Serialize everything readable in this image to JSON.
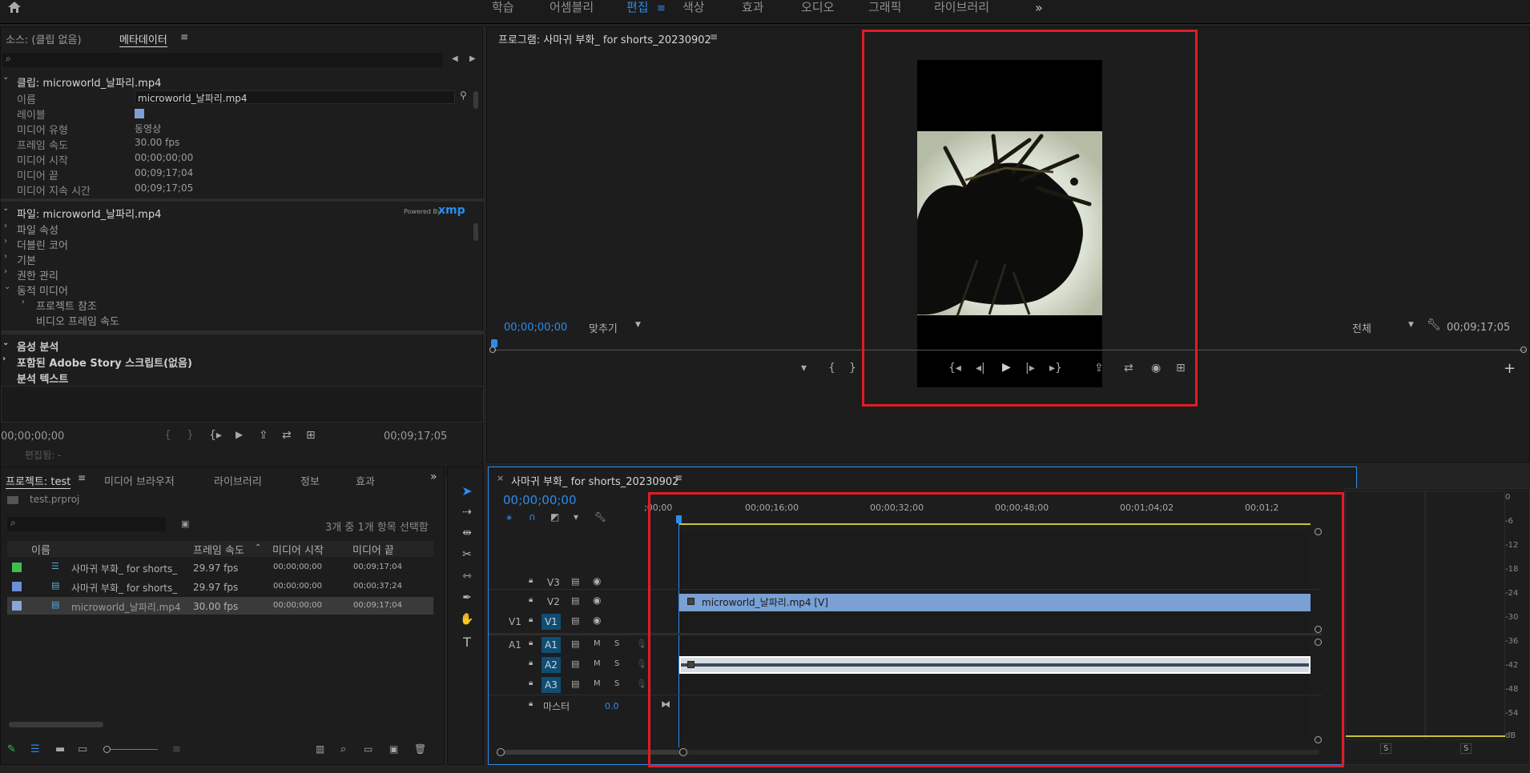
{
  "workspaces": [
    "학습",
    "어셈블리",
    "편집",
    "색상",
    "효과",
    "오디오",
    "그래픽",
    "라이브러리"
  ],
  "workspace_active": "편집",
  "source_panel": {
    "tab_source": "소스: (클립 없음)",
    "tab_metadata": "메타데이터",
    "clip_header": "클립: microworld_날파리.mp4",
    "rows": [
      {
        "label": "이름",
        "value": "microworld_날파리.mp4"
      },
      {
        "label": "레이블",
        "value": ""
      },
      {
        "label": "미디어 유형",
        "value": "동영상"
      },
      {
        "label": "프레임 속도",
        "value": "30.00 fps"
      },
      {
        "label": "미디어 시작",
        "value": "00;00;00;00"
      },
      {
        "label": "미디어 끝",
        "value": "00;09;17;04"
      },
      {
        "label": "미디어 지속 시간",
        "value": "00;09;17;05"
      }
    ],
    "file_header": "파일: microworld_날파리.mp4",
    "powered_by": "Powered By",
    "xmp": "xmp",
    "file_items": [
      "파일 속성",
      "더블린 코어",
      "기본",
      "권한 관리",
      "동적 미디어"
    ],
    "sub_items": [
      "프로젝트 참조",
      "비디오 프레임 속도"
    ],
    "section2": [
      "음성 분석",
      "포함된 Adobe Story 스크립트(없음)",
      "분석 텍스트"
    ],
    "timecode_left": "00;00;00;00",
    "timecode_right": "00;09;17;05",
    "edit_label": "편집됨: -"
  },
  "program_monitor": {
    "title": "프로그램: 사마귀 부화_ for shorts_20230902",
    "timecode": "00;00;00;00",
    "fit": "맞추기",
    "quality": "전체",
    "duration": "00;09;17;05"
  },
  "project_panel": {
    "tabs": [
      "프로젝트: test",
      "미디어 브라우저",
      "라이브러리",
      "정보",
      "효과"
    ],
    "file": "test.prproj",
    "selection": "3개 중 1개 항목 선택함",
    "columns": [
      "이름",
      "프레임 속도",
      "미디어 시작",
      "미디어 끝"
    ],
    "rows": [
      {
        "name": "사마귀 부화_ for shorts_",
        "fps": "29.97 fps",
        "start": "00;00;00;00",
        "end": "00;09;17;04",
        "color": "#3fbd4f"
      },
      {
        "name": "사마귀 부화_ for shorts_",
        "fps": "29.97 fps",
        "start": "00;00;00;00",
        "end": "00;00;37;24",
        "color": "#6d8fd6"
      },
      {
        "name": "microworld_날파리.mp4",
        "fps": "30.00 fps",
        "start": "00;00;00;00",
        "end": "00;09;17;04",
        "color": "#8aa6d6"
      }
    ]
  },
  "timeline": {
    "title": "사마귀 부화_ for shorts_20230902",
    "timecode": "00;00;00;00",
    "ruler": [
      ";00;00",
      "00;00;16;00",
      "00;00;32;00",
      "00;00;48;00",
      "00;01;04;02",
      "00;01;2"
    ],
    "video_tracks": [
      "V3",
      "V2",
      "V1"
    ],
    "audio_tracks": [
      "A1",
      "A2",
      "A3"
    ],
    "src_v1": "V1",
    "src_a1": "A1",
    "master": "마스터",
    "master_value": "0.0",
    "clip_label": "microworld_날파리.mp4 [V]",
    "m": "M",
    "s": "S"
  },
  "audio_meter": {
    "scale": [
      "0",
      "-6",
      "-12",
      "-18",
      "-24",
      "-30",
      "-36",
      "-42",
      "-48",
      "-54",
      "dB"
    ],
    "solo": "S"
  },
  "icons": [
    "home-icon",
    "workspace-overflow-icon",
    "play-icon",
    "wrench-icon",
    "add-icon",
    "selection-tool-icon",
    "razor-tool-icon",
    "pen-tool-icon",
    "hand-tool-icon",
    "type-tool-icon"
  ]
}
